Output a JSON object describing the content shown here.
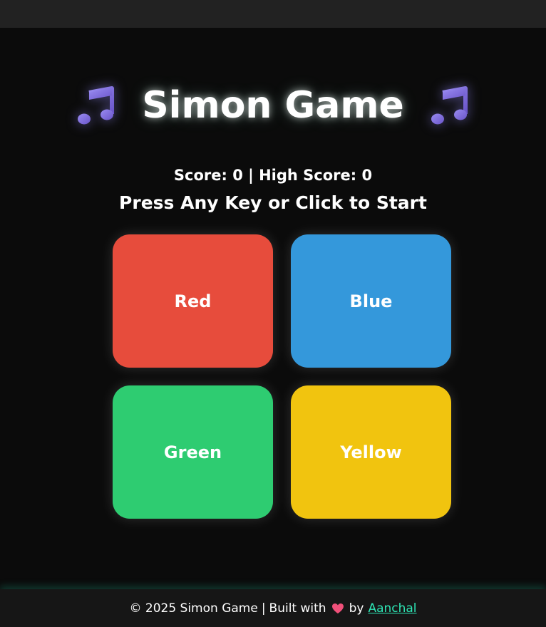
{
  "header": {
    "title": "Simon Game",
    "left_icon": "music-notes-icon",
    "right_icon": "music-notes-icon"
  },
  "score": {
    "score_label": "Score:",
    "score_value": "0",
    "separator": "|",
    "high_label": "High Score:",
    "high_value": "0"
  },
  "status": {
    "message": "Press Any Key or Click to Start"
  },
  "pads": [
    {
      "label": "Red",
      "color": "#e74c3c"
    },
    {
      "label": "Blue",
      "color": "#3498db"
    },
    {
      "label": "Green",
      "color": "#2ecc71"
    },
    {
      "label": "Yellow",
      "color": "#f1c40f"
    }
  ],
  "footer": {
    "copyright": "© 2025 Simon Game",
    "separator": "|",
    "built_with": "Built with",
    "heart_icon": "heart-icon",
    "by": "by",
    "author_link": "Aanchal",
    "link_color": "#2ee6b5"
  },
  "colors": {
    "background": "#0b0b0b",
    "top_bar": "#222222",
    "footer_bg": "#161616"
  }
}
